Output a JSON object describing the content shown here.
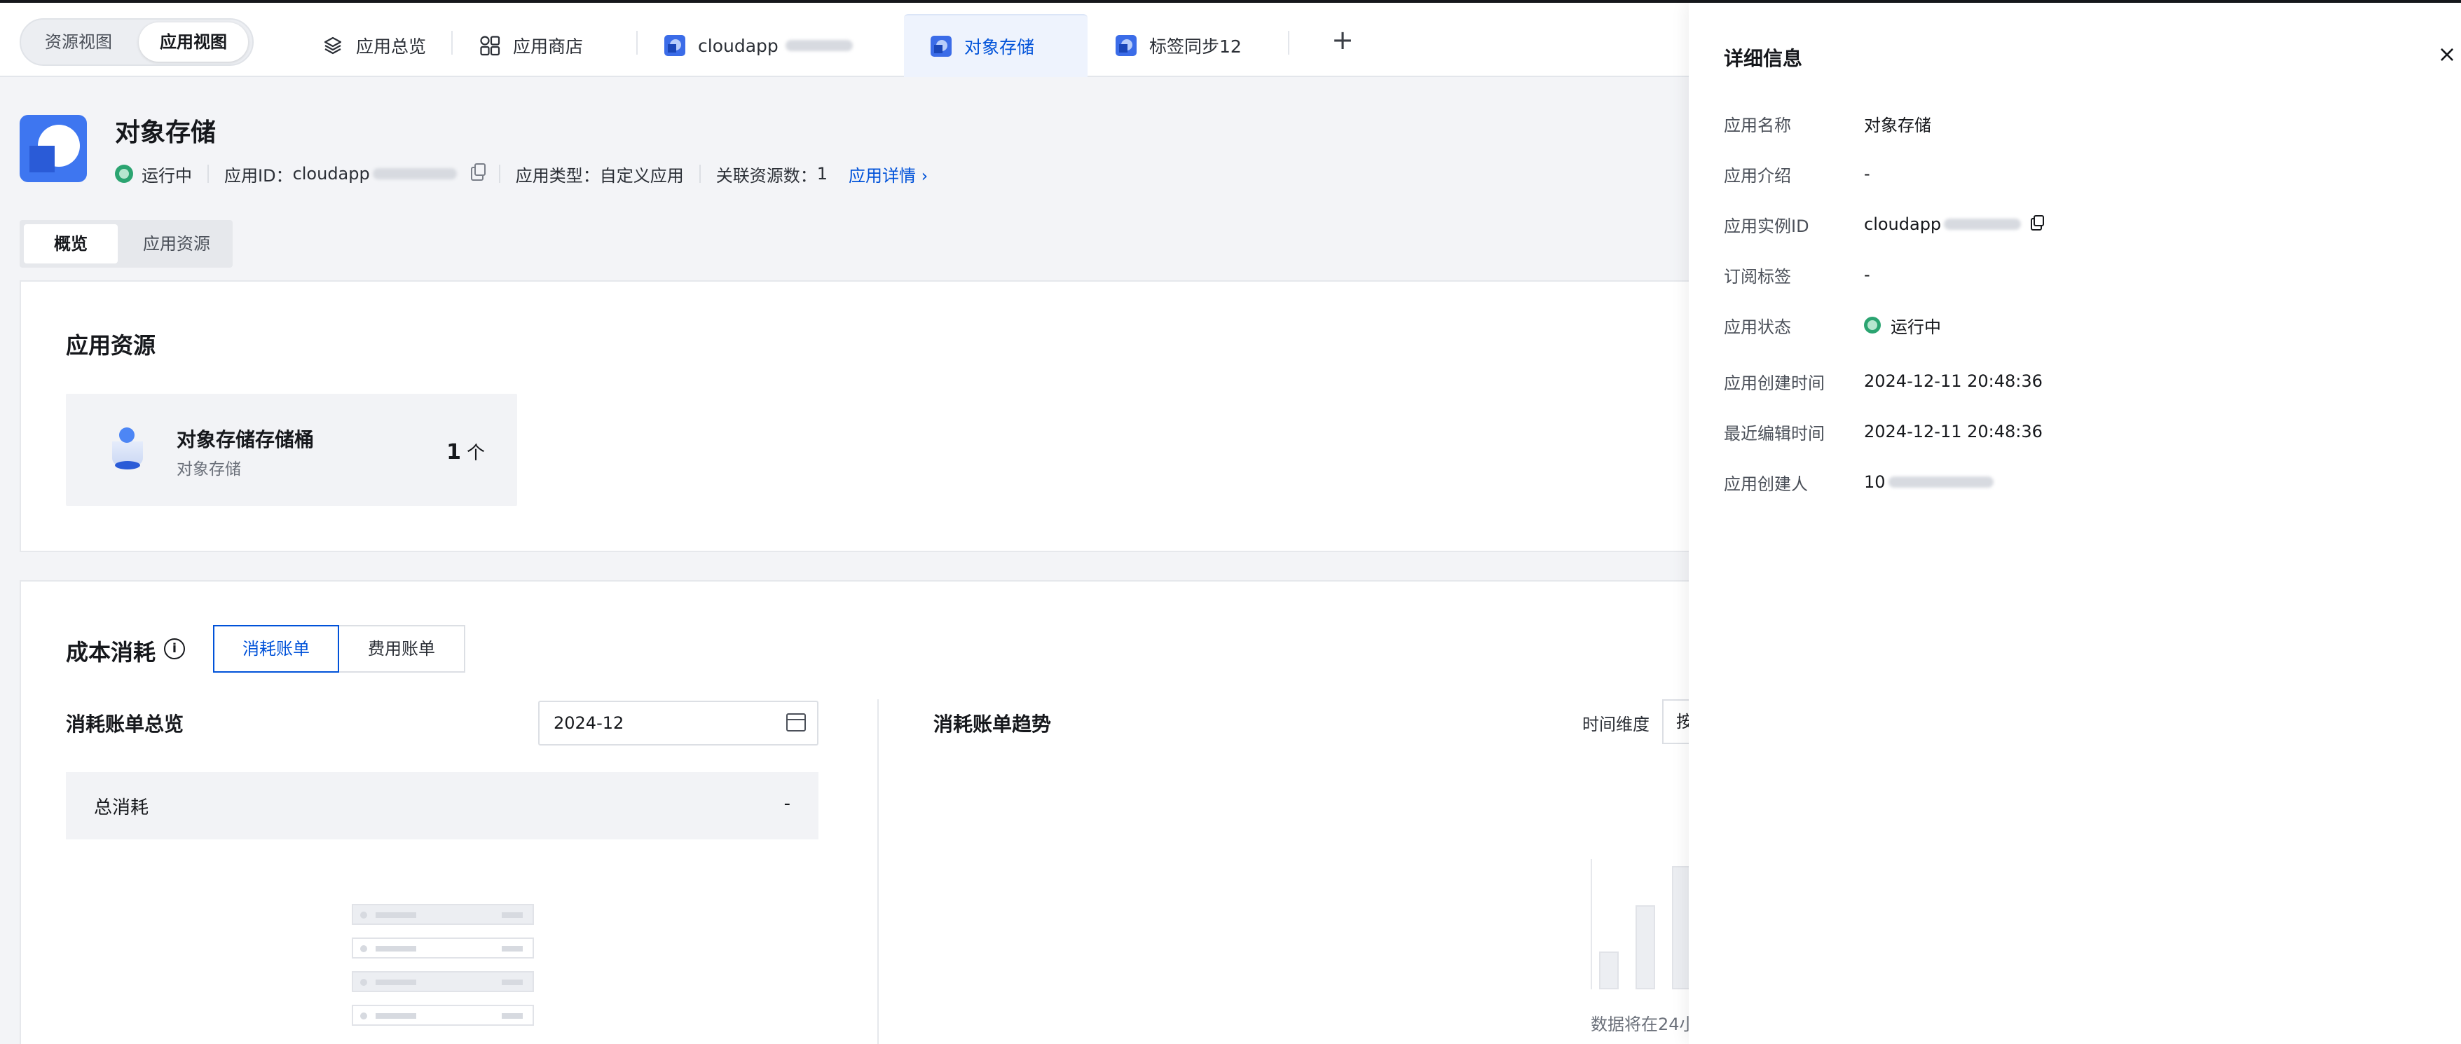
{
  "view_toggle": {
    "resource_view": "资源视图",
    "app_view": "应用视图"
  },
  "tabs": [
    {
      "label": "应用总览",
      "icon": "layers-icon"
    },
    {
      "label": "应用商店",
      "icon": "apps-grid-icon"
    },
    {
      "label": "cloudapp",
      "icon": "app-icon"
    },
    {
      "label": "对象存储",
      "icon": "app-icon",
      "active": true
    },
    {
      "label": "标签同步12",
      "icon": "app-icon"
    }
  ],
  "add_tab_symbol": "+",
  "app": {
    "title": "对象存储",
    "status": "运行中",
    "id_label": "应用ID：",
    "id_value": "cloudapp",
    "type_label": "应用类型：",
    "type_value": "自定义应用",
    "related_label": "关联资源数：",
    "related_value": "1",
    "detail_link": "应用详情",
    "detail_chevron": "›"
  },
  "subtabs": {
    "overview": "概览",
    "resources": "应用资源"
  },
  "resources_card": {
    "title": "应用资源",
    "item_name": "对象存储存储桶",
    "item_type": "对象存储",
    "item_count": "1",
    "item_unit": "个"
  },
  "cost_card": {
    "title": "成本消耗",
    "info_symbol": "i",
    "tab_consumption": "消耗账单",
    "tab_fee": "费用账单",
    "overview_title": "消耗账单总览",
    "month_value": "2024-12",
    "total_label": "总消耗",
    "total_value": "-",
    "trend_title": "消耗账单趋势",
    "dimension_label": "时间维度",
    "dimension_value": "按",
    "empty_hint": "数据将在24小"
  },
  "drawer": {
    "title": "详细信息",
    "close_symbol": "×",
    "rows": [
      {
        "key": "应用名称",
        "value": "对象存储"
      },
      {
        "key": "应用介绍",
        "value": "-"
      },
      {
        "key": "应用实例ID",
        "value": "cloudapp"
      },
      {
        "key": "订阅标签",
        "value": "-"
      },
      {
        "key": "应用状态",
        "value": "运行中"
      },
      {
        "key": "应用创建时间",
        "value": "2024-12-11 20:48:36"
      },
      {
        "key": "最近编辑时间",
        "value": "2024-12-11 20:48:36"
      },
      {
        "key": "应用创建人",
        "value": "10"
      }
    ]
  },
  "colors": {
    "accent": "#0052d9",
    "success": "#2ba471",
    "app_icon": "#3b6ce8"
  }
}
